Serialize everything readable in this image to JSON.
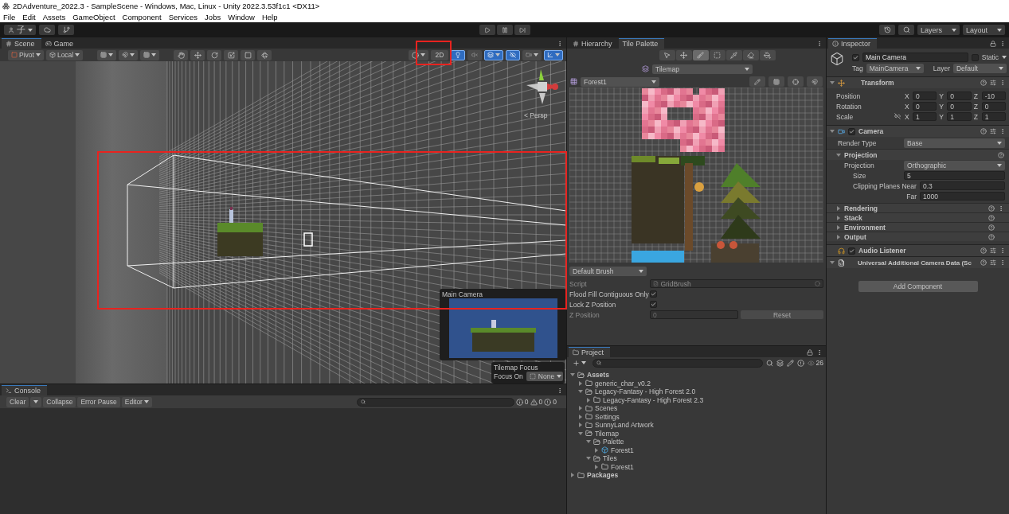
{
  "window": {
    "title": "2DAdventure_2022.3 - SampleScene - Windows, Mac, Linux - Unity 2022.3.53f1c1 <DX11>"
  },
  "menu": [
    "File",
    "Edit",
    "Assets",
    "GameObject",
    "Component",
    "Services",
    "Jobs",
    "Window",
    "Help"
  ],
  "toolbar": {
    "account_label": "子",
    "layers": "Layers",
    "layout": "Layout"
  },
  "scene_panel": {
    "tabs": [
      {
        "label": "Scene",
        "selected": true
      },
      {
        "label": "Game",
        "selected": false
      }
    ],
    "pivot": "Pivot",
    "local": "Local",
    "mode_2d": {
      "label": "2D",
      "selected": false
    },
    "view_toggles": [
      {
        "kind": "lighting",
        "on": true
      },
      {
        "kind": "audio",
        "on": false
      },
      {
        "kind": "effects",
        "on": true
      },
      {
        "kind": "visibility",
        "on": true
      },
      {
        "kind": "camera",
        "on": false
      },
      {
        "kind": "gizmos",
        "on": true
      }
    ],
    "persp_label": "< Persp",
    "camera_preview": {
      "title": "Main Camera"
    },
    "tilemap_focus": {
      "title": "Tilemap Focus",
      "label": "Focus On",
      "value": "None"
    }
  },
  "console": {
    "tab": "Console",
    "clear": "Clear",
    "collapse": "Collapse",
    "error_pause": "Error Pause",
    "editor": "Editor",
    "counts": [
      {
        "kind": "info",
        "count": "0"
      },
      {
        "kind": "warning",
        "count": "0"
      },
      {
        "kind": "error",
        "count": "0"
      }
    ]
  },
  "palette_panel": {
    "tabs": [
      {
        "label": "Hierarchy",
        "selected": false
      },
      {
        "label": "Tile Palette",
        "selected": true
      }
    ],
    "tools": [
      {
        "kind": "select",
        "selected": false
      },
      {
        "kind": "move",
        "selected": false
      },
      {
        "kind": "paint",
        "selected": true
      },
      {
        "kind": "box",
        "selected": false
      },
      {
        "kind": "pick",
        "selected": false
      },
      {
        "kind": "erase",
        "selected": false
      },
      {
        "kind": "fill",
        "selected": false
      }
    ],
    "tilemap": "Tilemap",
    "palette": "Forest1",
    "brush": "Default Brush",
    "script": {
      "label": "Script",
      "value": "GridBrush"
    },
    "flood_fill": {
      "label": "Flood Fill Contiguous Only",
      "checked": true
    },
    "lock_z": {
      "label": "Lock Z Position",
      "checked": true
    },
    "z_position": {
      "label": "Z Position",
      "value": "0",
      "disabled": true
    },
    "reset": "Reset"
  },
  "project_panel": {
    "tab": "Project",
    "count": "26",
    "tree": [
      {
        "label": "Assets",
        "kind": "folder",
        "expanded": true,
        "children": [
          {
            "label": "generic_char_v0.2",
            "kind": "folder",
            "expanded": false
          },
          {
            "label": "Legacy-Fantasy - High Forest 2.0",
            "kind": "folder",
            "expanded": true,
            "children": [
              {
                "label": "Legacy-Fantasy - High Forest 2.3",
                "kind": "folder",
                "expanded": false
              }
            ]
          },
          {
            "label": "Scenes",
            "kind": "folder",
            "expanded": false
          },
          {
            "label": "Settings",
            "kind": "folder",
            "expanded": false
          },
          {
            "label": "SunnyLand Artwork",
            "kind": "folder",
            "expanded": false
          },
          {
            "label": "Tilemap",
            "kind": "folder",
            "expanded": true,
            "children": [
              {
                "label": "Palette",
                "kind": "folder",
                "expanded": true,
                "children": [
                  {
                    "label": "Forest1",
                    "kind": "palette",
                    "expanded": false
                  }
                ]
              },
              {
                "label": "Tiles",
                "kind": "folder",
                "expanded": true,
                "children": [
                  {
                    "label": "Forest1",
                    "kind": "folder",
                    "expanded": false
                  }
                ]
              }
            ]
          }
        ]
      },
      {
        "label": "Packages",
        "kind": "folder",
        "expanded": false
      }
    ]
  },
  "inspector": {
    "tab": "Inspector",
    "object": {
      "name": "Main Camera",
      "active": true,
      "static_label": "Static",
      "static": false,
      "tag_label": "Tag",
      "tag": "MainCamera",
      "layer_label": "Layer",
      "layer": "Default"
    },
    "transform": {
      "title": "Transform",
      "rows": [
        {
          "label": "Position",
          "constrained": false,
          "values": [
            {
              "axis": "X",
              "value": "0"
            },
            {
              "axis": "Y",
              "value": "0"
            },
            {
              "axis": "Z",
              "value": "-10"
            }
          ]
        },
        {
          "label": "Rotation",
          "constrained": false,
          "values": [
            {
              "axis": "X",
              "value": "0"
            },
            {
              "axis": "Y",
              "value": "0"
            },
            {
              "axis": "Z",
              "value": "0"
            }
          ]
        },
        {
          "label": "Scale",
          "constrained": true,
          "values": [
            {
              "axis": "X",
              "value": "1"
            },
            {
              "axis": "Y",
              "value": "1"
            },
            {
              "axis": "Z",
              "value": "1"
            }
          ]
        }
      ]
    },
    "camera": {
      "title": "Camera",
      "enabled": true,
      "render_type_label": "Render Type",
      "render_type": "Base",
      "projection": {
        "title": "Projection",
        "expanded": true,
        "fields": [
          {
            "kind": "dropdown",
            "label": "Projection",
            "value": "Orthographic"
          },
          {
            "kind": "number",
            "label": "Size",
            "value": "5"
          },
          {
            "kind": "range_near",
            "label": "Clipping Planes Near",
            "value": "0.3"
          },
          {
            "kind": "range_far",
            "label": "Far",
            "value": "1000"
          }
        ]
      },
      "sections": [
        {
          "title": "Rendering",
          "expanded": false,
          "menu": true
        },
        {
          "title": "Stack",
          "expanded": false,
          "menu": false
        },
        {
          "title": "Environment",
          "expanded": false,
          "menu": false
        },
        {
          "title": "Output",
          "expanded": false,
          "menu": false
        }
      ]
    },
    "audio_listener": {
      "title": "Audio Listener",
      "enabled": true
    },
    "camera_data": {
      "title": "Universal Additional Camera Data (Sc"
    },
    "add_component": "Add Component"
  }
}
